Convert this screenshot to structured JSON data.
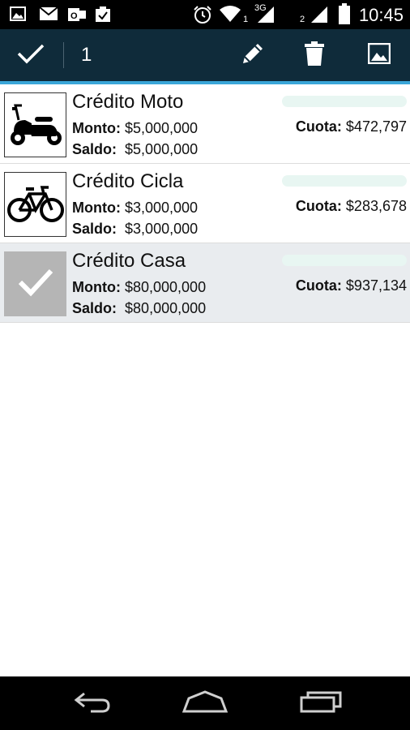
{
  "status_bar": {
    "time": "10:45",
    "network_type": "3G",
    "sim1_label": "1",
    "sim2_label": "2",
    "icons": [
      "gallery-icon",
      "email-icon",
      "outlook-icon",
      "clipboard-icon",
      "alarm-icon",
      "wifi-icon",
      "signal-icon",
      "signal-icon",
      "battery-icon"
    ]
  },
  "action_bar": {
    "selected_count": "1",
    "icons": [
      "check-icon",
      "edit-icon",
      "delete-icon",
      "image-icon"
    ],
    "background": "#0f2b3a",
    "accent": "#3aa6d8"
  },
  "list": {
    "monto_label": "Monto:",
    "saldo_label": "Saldo:",
    "cuota_label": "Cuota:",
    "items": [
      {
        "title": "Crédito Moto",
        "monto": "$5,000,000",
        "saldo": "$5,000,000",
        "cuota": "$472,797",
        "icon": "scooter-icon",
        "selected": false
      },
      {
        "title": "Crédito Cicla",
        "monto": "$3,000,000",
        "saldo": "$3,000,000",
        "cuota": "$283,678",
        "icon": "bicycle-icon",
        "selected": false
      },
      {
        "title": "Crédito Casa",
        "monto": "$80,000,000",
        "saldo": "$80,000,000",
        "cuota": "$937,134",
        "icon": "checkmark-icon",
        "selected": true
      }
    ]
  },
  "nav_bar": {
    "icons": [
      "back-icon",
      "home-icon",
      "recents-icon"
    ]
  }
}
